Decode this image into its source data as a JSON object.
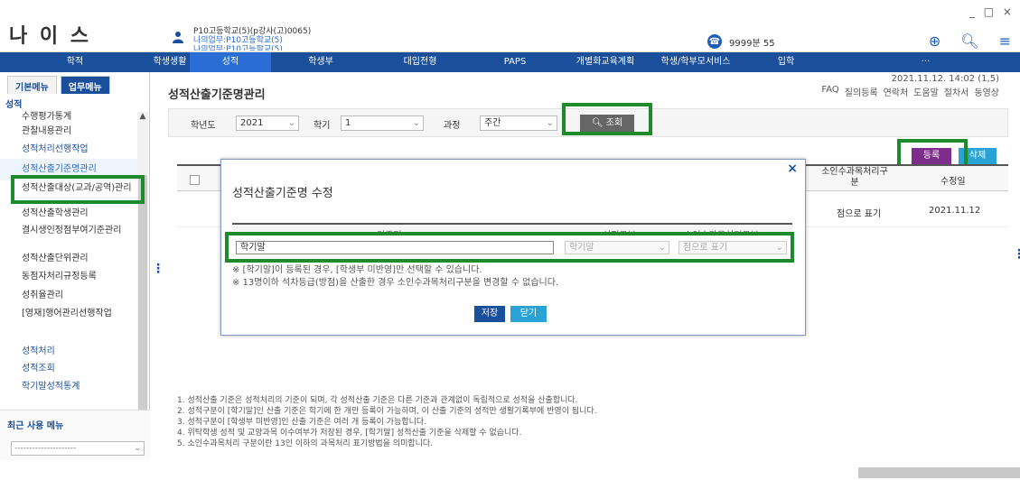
{
  "window": {
    "controls": "_ □ ×"
  },
  "app": {
    "logo": "나 이 스"
  },
  "user": {
    "line1": "P10고등학교(5)(p강사(고)0065)",
    "line2": "나의업무:P10고등학교(5)",
    "line3": "나의업무:P10고등학교(5)"
  },
  "messages": {
    "count": "9999분 55"
  },
  "topnav": [
    "학적",
    "학생생활",
    "성적",
    "학생부",
    "대입전형",
    "PAPS",
    "개별화교육계획",
    "학생/학부모서비스",
    "입학",
    "···"
  ],
  "left": {
    "tabs": [
      "기본메뉴",
      "업무메뉴"
    ],
    "section": "성적",
    "items": [
      "수행평가통계",
      "관찰내용관리",
      "성적처리선행작업",
      "성적산출기준명관리",
      "성적산출대상(교과/공역)관리",
      "성적산출학생관리",
      "결시생인정점부여기준관리",
      "성적산출단위관리",
      "동점자처리규정등록",
      "성취율관리",
      "[영재]행어관리선행작업",
      "성적처리",
      "성적조회",
      "학기말성적통계"
    ],
    "recent_label": "최근 사용 메뉴",
    "recent_value": "---------------------"
  },
  "page": {
    "title": "성적산출기준명관리",
    "timestamp": "2021.11.12. 14:02 (1,5)",
    "help": [
      "FAQ",
      "질의등록",
      "연락처",
      "도움말",
      "절차서",
      "동영상"
    ]
  },
  "search": {
    "year_label": "학년도",
    "year_value": "2021",
    "term_label": "학기",
    "term_value": "1",
    "course_label": "과정",
    "course_value": "주간",
    "button": "조회"
  },
  "buttons": {
    "register": "등록",
    "delete": "삭제"
  },
  "table": {
    "col_scale": "소인수과목처리구분",
    "col_date": "수정일",
    "row": {
      "scale": "점으로 표기",
      "date": "2021.11.12"
    }
  },
  "modal": {
    "title": "성적산출기준명 수정",
    "headers": [
      "기준명",
      "성적구분",
      "소인수과목처리구분"
    ],
    "name_value": "학기말",
    "grade_value": "학기말",
    "scale_value": "점으로 표기",
    "notes": [
      "※ [학기말]이 등록된 경우, [학생부 미반영]만 선택할 수 있습니다.",
      "※ 13명이하 석차등급(방점)을 산출한 경우 소인수과목처리구분을 변경할 수 없습니다."
    ],
    "save": "저장",
    "close": "닫기"
  },
  "notes": [
    "1. 성적산출 기준은 성적처리의 기준이 되며, 각 성적산출 기준은 다른 기준과 관계없이 독립적으로 성적을 산출합니다.",
    "2. 성적구분이 [학기말]인 산출 기준은 학기에 한 개만 등록이 가능하며, 이 산출 기준의 성적만 생활기록부에 반영이 됩니다.",
    "3. 성적구분이 [학생부 미반영]인 산출 기준은 여러 개 등록이 가능합니다.",
    "4. 위탁학생 성적 및 교양과목 이수여부가 저장된 경우, [학기말] 성적산출 기준을 삭제할 수 없습니다.",
    "5. 소인수과목처리 구분이란 13인 이하의 과목처리 표기방법을 의미합니다."
  ],
  "colors": {
    "nav": "#1a4f9c",
    "highlight": "#1d8a2c",
    "register": "#7d2e8a",
    "delete": "#29a3d6"
  }
}
